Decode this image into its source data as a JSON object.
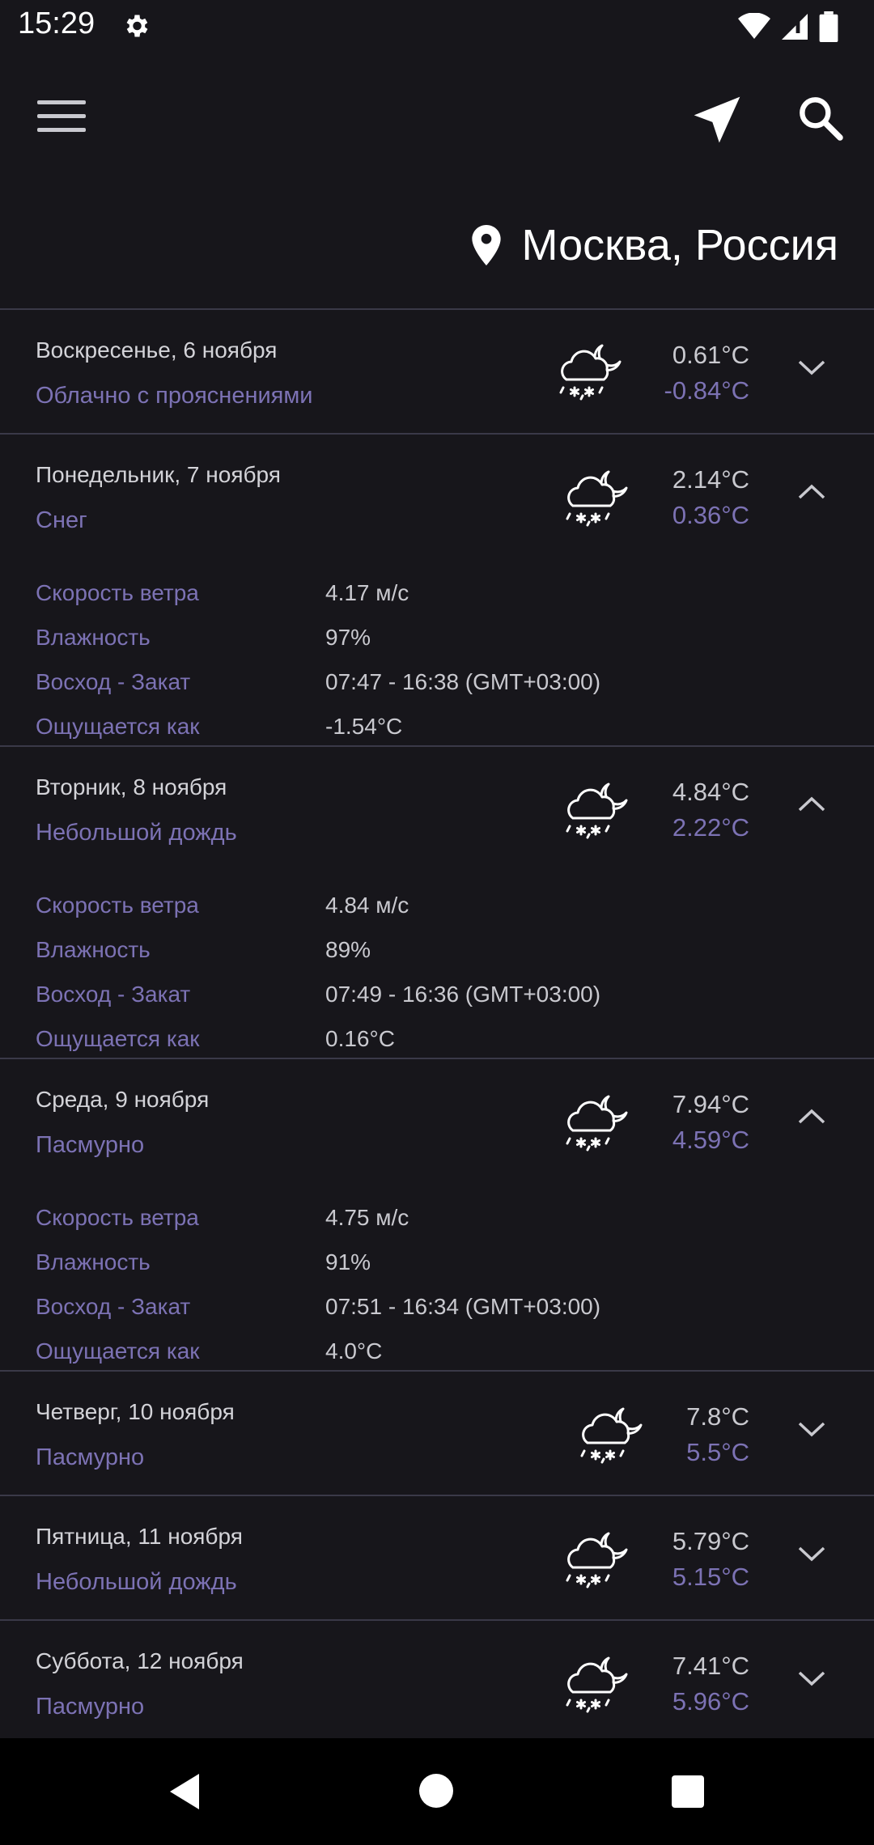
{
  "status": {
    "time": "15:29",
    "icons": [
      "gear-icon",
      "wifi-icon",
      "signal-icon",
      "battery-icon"
    ]
  },
  "appbar": {
    "icons": [
      "menu-icon",
      "navigation-icon",
      "search-icon"
    ]
  },
  "location": "Москва, Россия",
  "labels": {
    "wind": "Скорость ветра",
    "humidity": "Влажность",
    "sun": "Восход - Закат",
    "feels": "Ощущается как"
  },
  "days": [
    {
      "date": "Воскресенье, 6 ноября",
      "condition": "Облачно с прояснениями",
      "high": "0.61°C",
      "low": "-0.84°C",
      "expanded": false
    },
    {
      "date": "Понедельник, 7 ноября",
      "condition": "Снег",
      "high": "2.14°C",
      "low": "0.36°C",
      "expanded": true,
      "wind": "4.17 м/с",
      "humidity": "97%",
      "sun": "07:47 - 16:38 (GMT+03:00)",
      "feels": "-1.54°C"
    },
    {
      "date": "Вторник, 8 ноября",
      "condition": "Небольшой дождь",
      "high": "4.84°C",
      "low": "2.22°C",
      "expanded": true,
      "wind": "4.84 м/с",
      "humidity": "89%",
      "sun": "07:49 - 16:36 (GMT+03:00)",
      "feels": "0.16°C"
    },
    {
      "date": "Среда, 9 ноября",
      "condition": "Пасмурно",
      "high": "7.94°C",
      "low": "4.59°C",
      "expanded": true,
      "wind": "4.75 м/с",
      "humidity": "91%",
      "sun": "07:51 - 16:34 (GMT+03:00)",
      "feels": "4.0°C"
    },
    {
      "date": "Четверг, 10 ноября",
      "condition": "Пасмурно",
      "high": "7.8°C",
      "low": "5.5°C",
      "expanded": false
    },
    {
      "date": "Пятница, 11 ноября",
      "condition": "Небольшой дождь",
      "high": "5.79°C",
      "low": "5.15°C",
      "expanded": false
    },
    {
      "date": "Суббота, 12 ноября",
      "condition": "Пасмурно",
      "high": "7.41°C",
      "low": "5.96°C",
      "expanded": false
    }
  ],
  "colors": {
    "background": "#17161b",
    "accent": "#7c72b4",
    "divider": "#3a3948"
  }
}
